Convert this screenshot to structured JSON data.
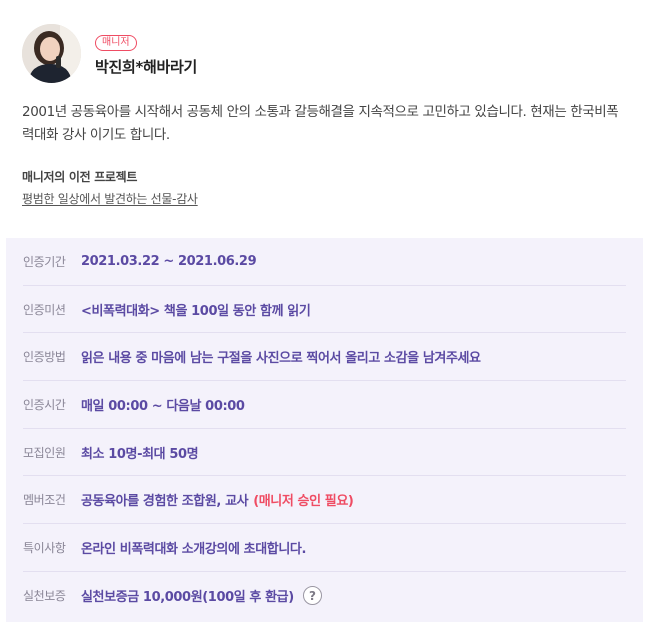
{
  "manager": {
    "badge": "매니저",
    "name": "박진희*해바라기",
    "bio": "2001년 공동육아를 시작해서 공동체 안의 소통과 갈등해결을 지속적으로 고민하고 있습니다. 현재는 한국비폭력대화 강사 이기도 합니다."
  },
  "previous_projects": {
    "title": "매니저의 이전 프로젝트",
    "link": "평범한 일상에서 발견하는 선물-감사"
  },
  "details": [
    {
      "label": "인증기간",
      "value": "2021.03.22 ~ 2021.06.29",
      "note": ""
    },
    {
      "label": "인증미션",
      "value": "<비폭력대화> 책을 100일 동안 함께 읽기",
      "note": ""
    },
    {
      "label": "인증방법",
      "value": "읽은 내용 중 마음에 남는 구절을 사진으로 찍어서 올리고 소감을 남겨주세요",
      "note": ""
    },
    {
      "label": "인증시간",
      "value": "매일 00:00 ~ 다음날 00:00",
      "note": ""
    },
    {
      "label": "모집인원",
      "value": "최소 10명-최대 50명",
      "note": ""
    },
    {
      "label": "멤버조건",
      "value": "공동육아를 경험한 조합원, 교사",
      "note": "(매니저 승인 필요)"
    },
    {
      "label": "특이사항",
      "value": "온라인 비폭력대화 소개강의에 초대합니다.",
      "note": ""
    },
    {
      "label": "실천보증",
      "value": "실천보증금 10,000원(100일 후 환급)",
      "note": "",
      "help": "?"
    }
  ],
  "colors": {
    "accent": "#5b4aa3",
    "badge": "#ef4c63",
    "panel": "#f4f2fb"
  }
}
